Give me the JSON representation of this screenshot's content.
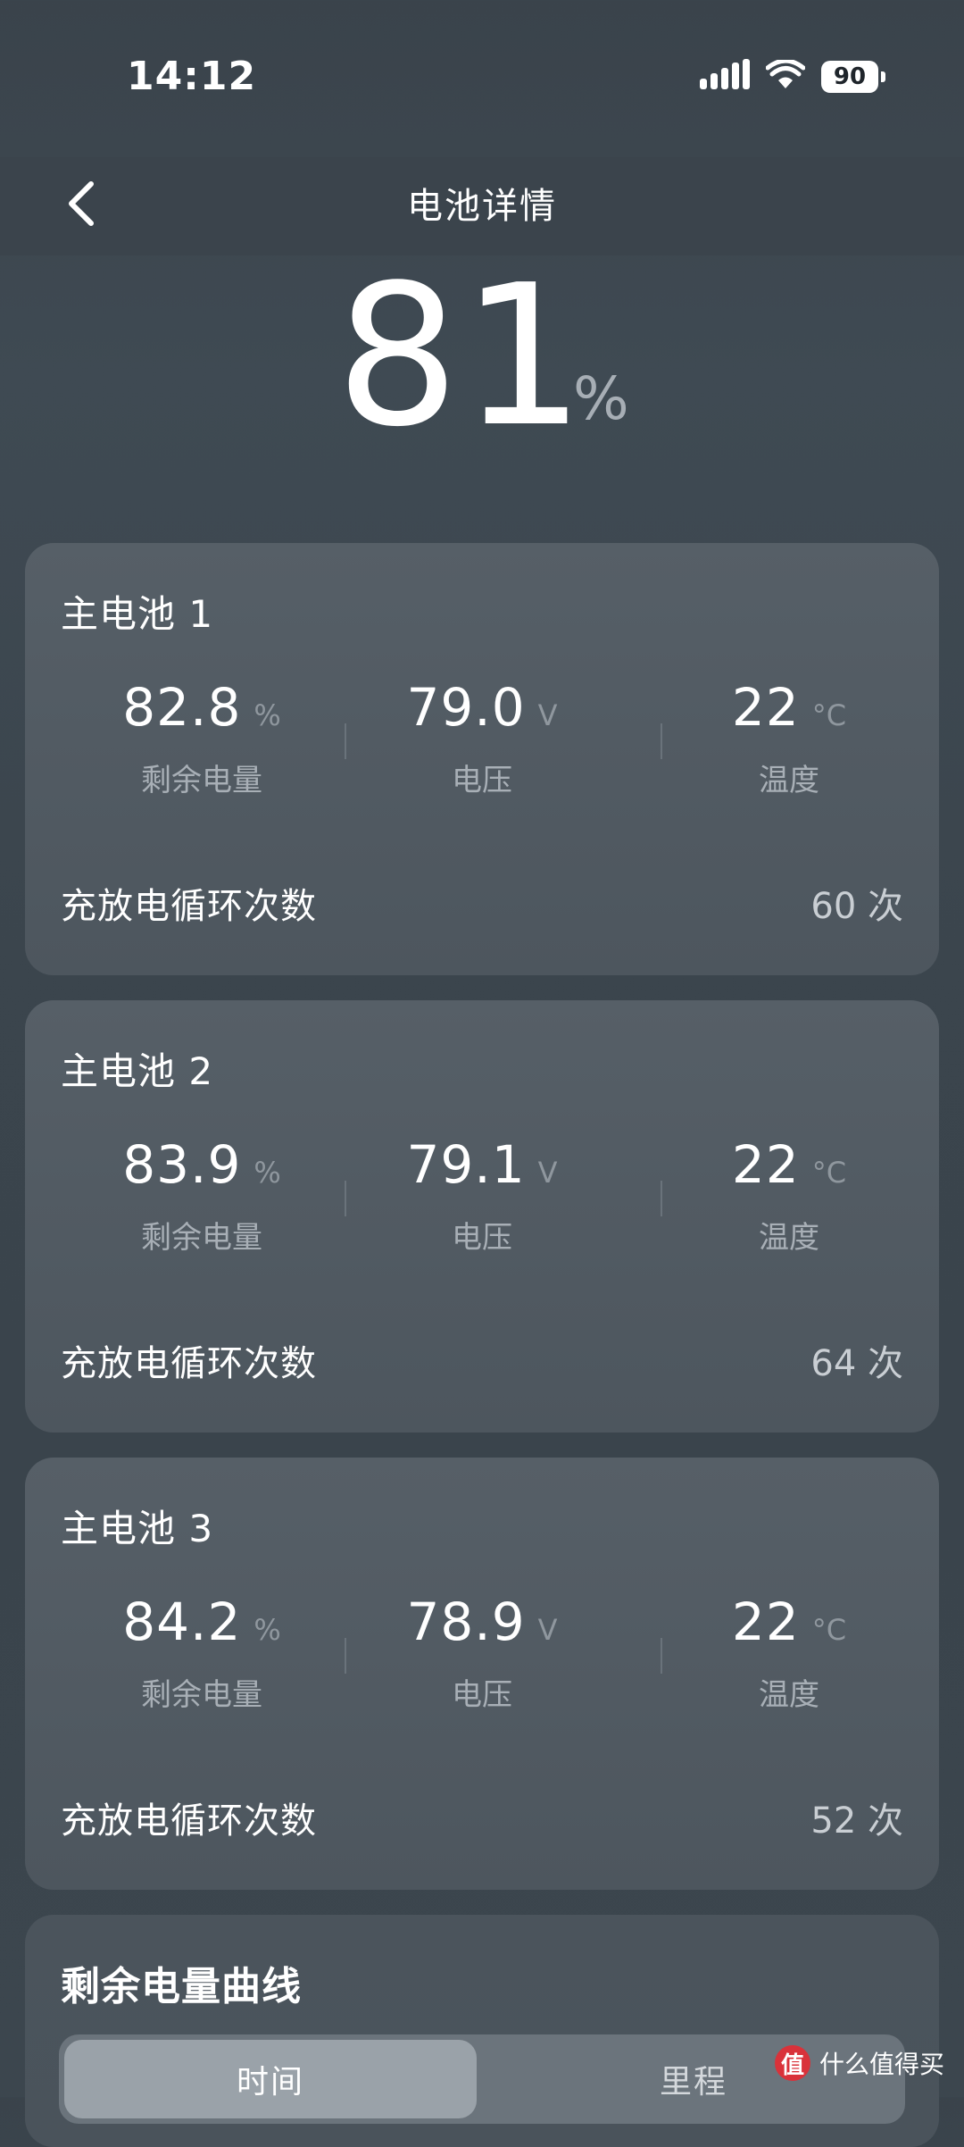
{
  "status_bar": {
    "time": "14:12",
    "battery_level": "90",
    "icons": [
      "signal-icon",
      "wifi-icon",
      "battery-icon"
    ]
  },
  "header": {
    "title": "电池详情",
    "back_icon": "chevron-left-icon"
  },
  "overall": {
    "value": "81",
    "unit": "%"
  },
  "batteries": [
    {
      "title": "主电池 1",
      "charge": "82.8",
      "charge_unit": "%",
      "charge_label": "剩余电量",
      "voltage": "79.0",
      "voltage_unit": "V",
      "voltage_label": "电压",
      "temp": "22",
      "temp_unit": "°C",
      "temp_label": "温度",
      "cycle_label": "充放电循环次数",
      "cycle_value": "60 次"
    },
    {
      "title": "主电池 2",
      "charge": "83.9",
      "charge_unit": "%",
      "charge_label": "剩余电量",
      "voltage": "79.1",
      "voltage_unit": "V",
      "voltage_label": "电压",
      "temp": "22",
      "temp_unit": "°C",
      "temp_label": "温度",
      "cycle_label": "充放电循环次数",
      "cycle_value": "64 次"
    },
    {
      "title": "主电池 3",
      "charge": "84.2",
      "charge_unit": "%",
      "charge_label": "剩余电量",
      "voltage": "78.9",
      "voltage_unit": "V",
      "voltage_label": "电压",
      "temp": "22",
      "temp_unit": "°C",
      "temp_label": "温度",
      "cycle_label": "充放电循环次数",
      "cycle_value": "52 次"
    }
  ],
  "curve": {
    "title": "剩余电量曲线",
    "tabs": [
      {
        "label": "时间",
        "active": true
      },
      {
        "label": "里程",
        "active": false
      }
    ]
  },
  "watermark": {
    "badge": "值",
    "text": "什么值得买"
  }
}
